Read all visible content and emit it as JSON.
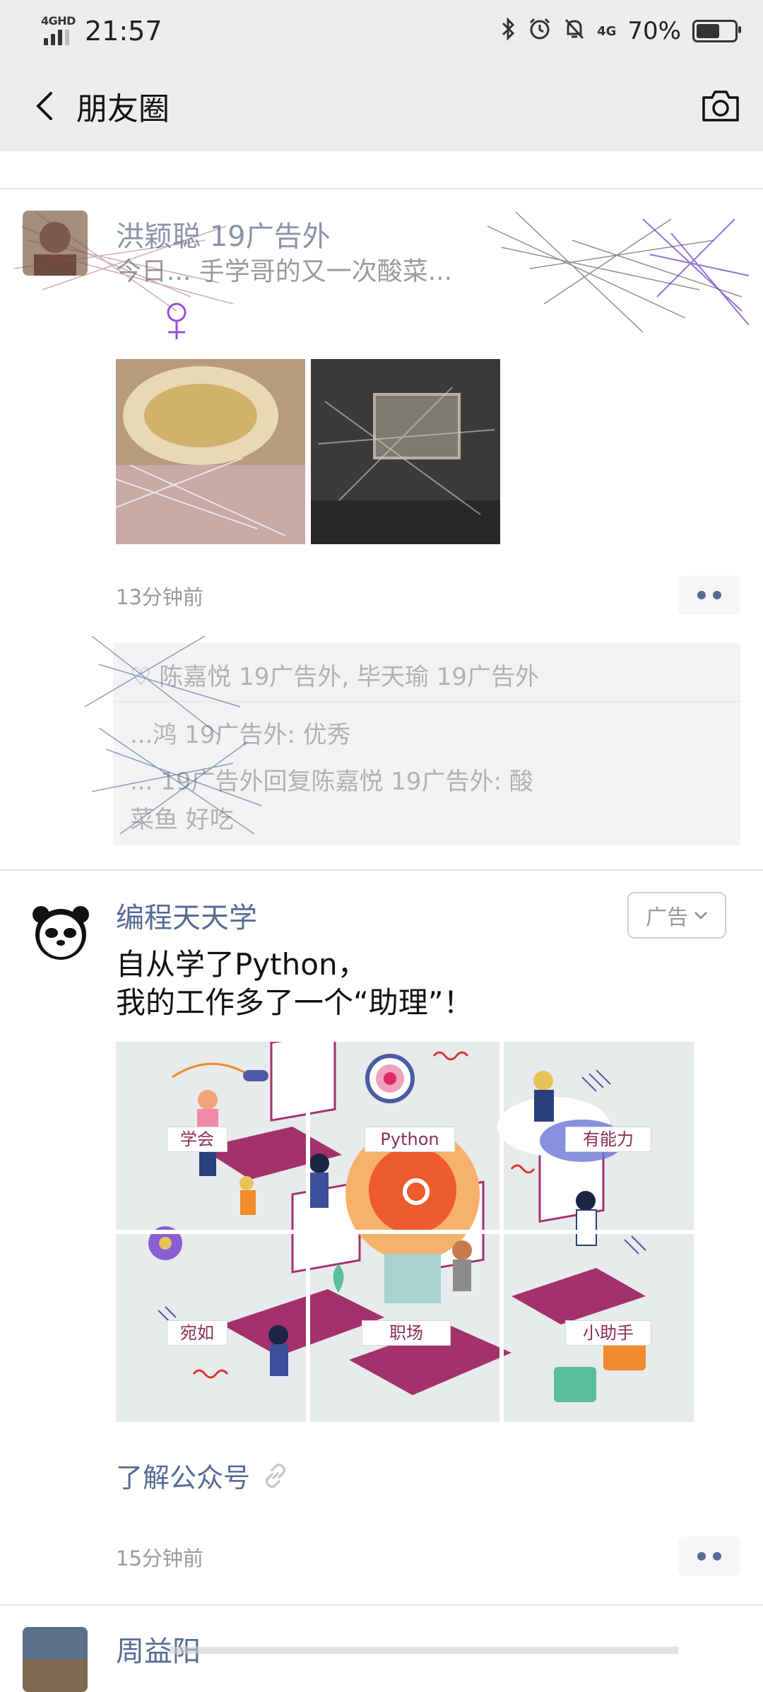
{
  "status_bar": {
    "network_tag": "4GHD",
    "time": "21:57",
    "signal_small": "4G",
    "battery_percent": "70%",
    "battery_level": 0.7,
    "icons": [
      "bluetooth-icon",
      "alarm-icon",
      "mute-icon",
      "signal-icon",
      "battery-icon"
    ]
  },
  "nav": {
    "title": "朋友圈",
    "back_icon": "back-chevron-icon",
    "camera_icon": "camera-icon"
  },
  "post1": {
    "author": "洪颖聪 19广告外",
    "text": "今日... 手学哥的又一次酸菜...",
    "photos": [
      "food-photo",
      "screen-photo"
    ],
    "timestamp": "13分钟前",
    "comments": [
      "♡ 陈嘉悦 19广告外, 毕天瑜 19广告外",
      "...鸿 19广告外: 优秀",
      "... 19广告外回复陈嘉悦 19广告外: 酸",
      "菜鱼 好吃"
    ]
  },
  "post2": {
    "author": "编程天天学",
    "ad_label": "广告",
    "text_line1": "自从学了Python，",
    "text_line2": "我的工作多了一个“助理”！",
    "grid_labels": [
      "学会",
      "Python",
      "有能力",
      "宛如",
      "职场",
      "小助手"
    ],
    "link_text": "了解公众号",
    "timestamp": "15分钟前"
  },
  "post3": {
    "author": "周益阳"
  },
  "colors": {
    "author_blue": "#576b95",
    "bar_gray": "#ededed",
    "grid_magenta": "#8a2e5c",
    "grid_orange": "#f08a2c"
  }
}
